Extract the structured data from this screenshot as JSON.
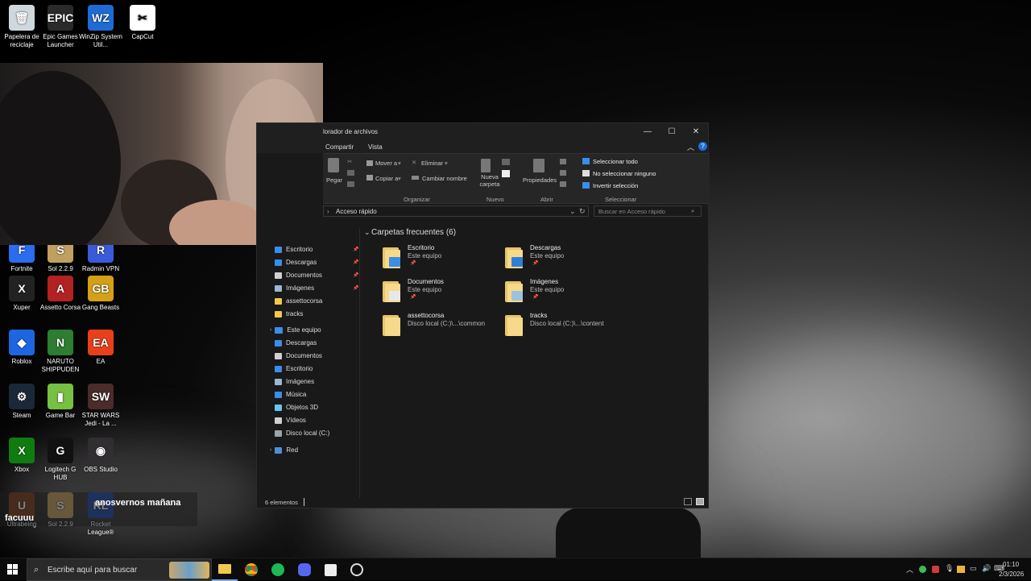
{
  "desktop": {
    "icons": [
      {
        "label": "Papelera de reciclaje",
        "glyph": "🗑",
        "color": "#cfd8dc"
      },
      {
        "label": "Epic Games Launcher",
        "glyph": "EPIC",
        "color": "#2a2a2a"
      },
      {
        "label": "WinZip System Util...",
        "glyph": "WZ",
        "color": "#1e6bd6"
      },
      {
        "label": "CapCut",
        "glyph": "✂",
        "color": "#ffffff"
      },
      {
        "label": "Fortnite",
        "glyph": "F",
        "color": "#2b6cf0"
      },
      {
        "label": "Sol 2.2.9",
        "glyph": "S",
        "color": "#c0a060"
      },
      {
        "label": "Radmin VPN",
        "glyph": "R",
        "color": "#3a5bd9"
      },
      {
        "label": "Xuper",
        "glyph": "X",
        "color": "#222"
      },
      {
        "label": "Assetto Corsa",
        "glyph": "A",
        "color": "#b22222"
      },
      {
        "label": "Gang Beasts",
        "glyph": "GB",
        "color": "#d4a017"
      },
      {
        "label": "Roblox",
        "glyph": "◆",
        "color": "#1e66e0"
      },
      {
        "label": "NARUTO SHIPPUDEN",
        "glyph": "N",
        "color": "#2e7d32"
      },
      {
        "label": "EA",
        "glyph": "EA",
        "color": "#e8401c"
      },
      {
        "label": "Steam",
        "glyph": "⚙",
        "color": "#1b2838"
      },
      {
        "label": "Game Bar",
        "glyph": "▮",
        "color": "#76c043"
      },
      {
        "label": "STAR WARS Jedi - La ...",
        "glyph": "SW",
        "color": "#4a2c2a"
      },
      {
        "label": "Xbox",
        "glyph": "X",
        "color": "#107c10"
      },
      {
        "label": "Logitech G HUB",
        "glyph": "G",
        "color": "#111"
      },
      {
        "label": "OBS Studio",
        "glyph": "◉",
        "color": "#302e31"
      },
      {
        "label": "Ultrabeing",
        "glyph": "U",
        "color": "#7a3e1d"
      },
      {
        "label": "Sol 2.2.9",
        "glyph": "S",
        "color": "#c0a060"
      },
      {
        "label": "Rocket League®",
        "glyph": "RL",
        "color": "#1f4aa8"
      }
    ],
    "overlay_text": "anosvernos mañana",
    "overlay_name": "facuuu"
  },
  "explorer": {
    "title": "lorador de archivos",
    "menu": [
      "Compartir",
      "Vista"
    ],
    "ribbon": {
      "paste": "Pegar",
      "move_to": "Mover a",
      "copy_to": "Copiar a",
      "delete": "Eliminar",
      "rename": "Cambiar nombre",
      "new_folder": "Nueva carpeta",
      "properties": "Propiedades",
      "select_all": "Seleccionar todo",
      "select_none": "No seleccionar ninguno",
      "invert_selection": "Invertir selección",
      "groups": [
        "Organizar",
        "Nuevo",
        "Abrir",
        "Seleccionar"
      ]
    },
    "address": "Acceso rápido",
    "search_placeholder": "Buscar en Acceso rápido",
    "nav": {
      "quick": [
        {
          "label": "Escritorio",
          "color": "#3a8ee6",
          "pinned": true
        },
        {
          "label": "Descargas",
          "color": "#3a8ee6",
          "pinned": true
        },
        {
          "label": "Documentos",
          "color": "#d0d0d0",
          "pinned": true
        },
        {
          "label": "Imágenes",
          "color": "#9ab7d3",
          "pinned": true
        },
        {
          "label": "assettocorsa",
          "color": "#f2c94c",
          "pinned": false
        },
        {
          "label": "tracks",
          "color": "#f2c94c",
          "pinned": false
        }
      ],
      "this_pc": "Este equipo",
      "pc_items": [
        {
          "label": "Descargas",
          "color": "#3a8ee6"
        },
        {
          "label": "Documentos",
          "color": "#d0d0d0"
        },
        {
          "label": "Escritorio",
          "color": "#3a8ee6"
        },
        {
          "label": "Imágenes",
          "color": "#9ab7d3"
        },
        {
          "label": "Música",
          "color": "#3a8ee6"
        },
        {
          "label": "Objetos 3D",
          "color": "#6cc4e8"
        },
        {
          "label": "Vídeos",
          "color": "#d0d0d0"
        },
        {
          "label": "Disco local (C:)",
          "color": "#9aa4ad"
        }
      ],
      "network": "Red"
    },
    "section_title": "Carpetas frecuentes (6)",
    "folders": [
      {
        "name": "Escritorio",
        "sub": "Este equipo",
        "pinned": true,
        "overlay": "#3a8ee6"
      },
      {
        "name": "Descargas",
        "sub": "Este equipo",
        "pinned": true,
        "overlay": "#2f7fd8"
      },
      {
        "name": "Documentos",
        "sub": "Este equipo",
        "pinned": true,
        "overlay": "#e8e8e8"
      },
      {
        "name": "Imágenes",
        "sub": "Este equipo",
        "pinned": true,
        "overlay": "#9ec1de"
      },
      {
        "name": "assettocorsa",
        "sub": "Disco local (C:)\\...\\common",
        "pinned": false,
        "overlay": ""
      },
      {
        "name": "tracks",
        "sub": "Disco local (C:)\\...\\content",
        "pinned": false,
        "overlay": ""
      }
    ],
    "status": "6 elementos"
  },
  "taskbar": {
    "search_placeholder": "Escribe aquí para buscar",
    "time": "01:10",
    "date": "2/3/2026"
  }
}
